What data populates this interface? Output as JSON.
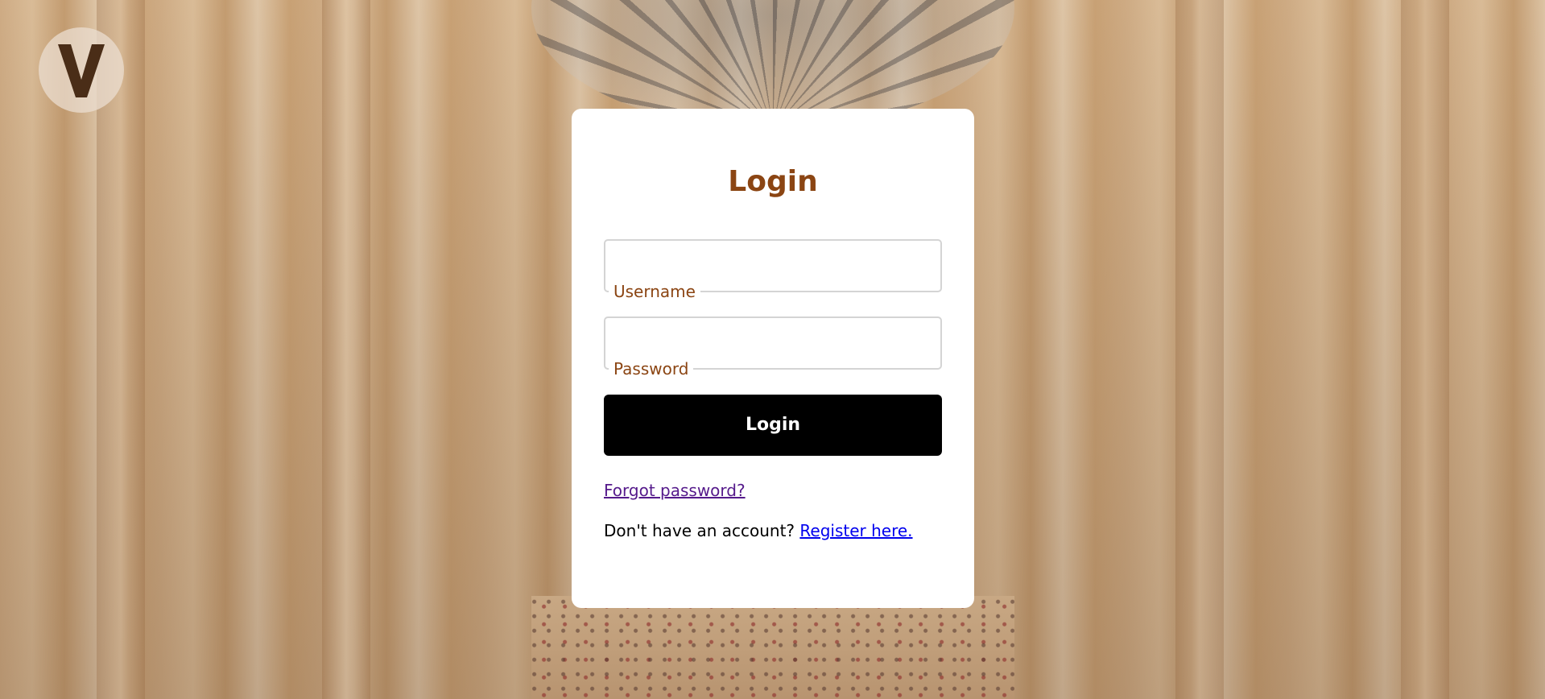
{
  "logo": {
    "letter": "V"
  },
  "login_card": {
    "title": "Login",
    "username": {
      "label": "Username",
      "value": ""
    },
    "password": {
      "label": "Password",
      "value": ""
    },
    "submit_label": "Login",
    "forgot_password_link": "Forgot password?",
    "register_prompt": "Don't have an account?",
    "register_link": "Register here."
  },
  "colors": {
    "title": "#8b4513",
    "label": "#8b4513",
    "button_bg": "#000000",
    "button_text": "#ffffff",
    "visited_link": "#551a8b",
    "link": "#0000ee"
  }
}
